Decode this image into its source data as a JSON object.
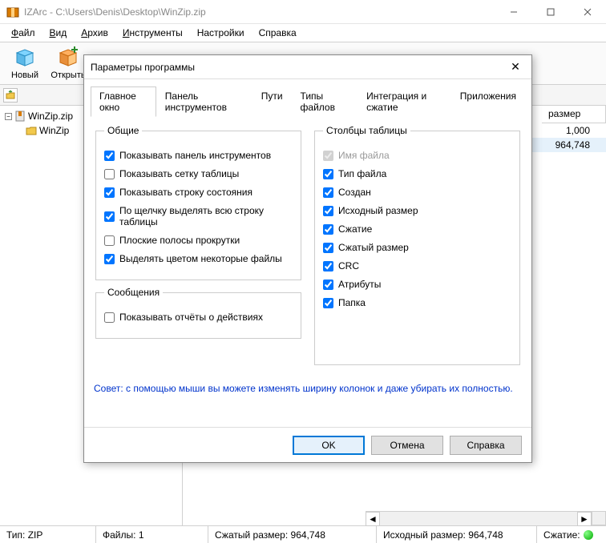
{
  "window": {
    "title": "IZArc - C:\\Users\\Denis\\Desktop\\WinZip.zip"
  },
  "menu": {
    "file": "Файл",
    "view": "Вид",
    "archive": "Архив",
    "tools": "Инструменты",
    "settings": "Настройки",
    "help": "Справка"
  },
  "toolbar": {
    "new": "Новый",
    "open": "Открыть"
  },
  "tree": {
    "root": "WinZip.zip",
    "child": "WinZip"
  },
  "list": {
    "col_size": "размер",
    "rows": [
      "1,000",
      "964,748"
    ]
  },
  "status": {
    "type_label": "Тип:",
    "type_value": "ZIP",
    "files_label": "Файлы:",
    "files_value": "1",
    "compressed_label": "Сжатый размер:",
    "compressed_value": "964,748",
    "original_label": "Исходный размер:",
    "original_value": "964,748",
    "ratio_label": "Сжатие:"
  },
  "dialog": {
    "title": "Параметры программы",
    "tabs": {
      "main": "Главное окно",
      "toolbar": "Панель инструментов",
      "paths": "Пути",
      "filetypes": "Типы файлов",
      "integration": "Интеграция и сжатие",
      "apps": "Приложения"
    },
    "groups": {
      "general": "Общие",
      "messages": "Сообщения",
      "columns": "Столбцы таблицы"
    },
    "general": {
      "show_toolbar": "Показывать панель инструментов",
      "show_grid": "Показывать сетку таблицы",
      "show_status": "Показывать строку состояния",
      "full_row": "По щелчку выделять всю строку таблицы",
      "flat_scroll": "Плоские полосы прокрутки",
      "color_files": "Выделять цветом некоторые файлы"
    },
    "messages": {
      "show_reports": "Показывать отчёты о действиях"
    },
    "columns": {
      "filename": "Имя файла",
      "filetype": "Тип файла",
      "created": "Создан",
      "orig_size": "Исходный размер",
      "ratio": "Сжатие",
      "packed_size": "Сжатый размер",
      "crc": "CRC",
      "attrs": "Атрибуты",
      "folder": "Папка"
    },
    "hint": "Совет: с помощью мыши вы можете изменять ширину колонок и даже убирать их полностью.",
    "buttons": {
      "ok": "OK",
      "cancel": "Отмена",
      "help": "Справка"
    }
  }
}
